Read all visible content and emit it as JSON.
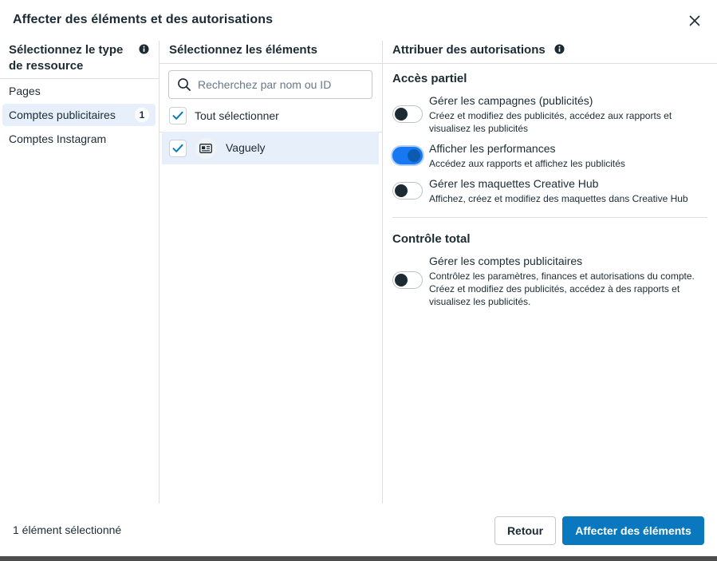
{
  "dialog": {
    "title": "Affecter des éléments et des autorisations"
  },
  "resource_types": {
    "heading": "Sélectionnez le type de ressource",
    "items": [
      {
        "label": "Pages",
        "count": ""
      },
      {
        "label": "Comptes publicitaires",
        "count": "1"
      },
      {
        "label": "Comptes Instagram",
        "count": ""
      }
    ],
    "active_index": 1
  },
  "elements": {
    "heading": "Sélectionnez les éléments",
    "search_placeholder": "Recherchez par nom ou ID",
    "select_all_label": "Tout sélectionner",
    "select_all_checked": true,
    "items": [
      {
        "name": "Vaguely",
        "checked": true
      }
    ]
  },
  "permissions": {
    "heading": "Attribuer des autorisations",
    "partial_title": "Accès partiel",
    "partial": [
      {
        "title": "Gérer les campagnes (publicités)",
        "desc": "Créez et modifiez des publicités, accédez aux rapports et visualisez les publicités",
        "enabled": false
      },
      {
        "title": "Afficher les performances",
        "desc": "Accédez aux rapports et affichez les publicités",
        "enabled": true
      },
      {
        "title": "Gérer les maquettes Creative Hub",
        "desc": "Affichez, créez et modifiez des maquettes dans Creative Hub",
        "enabled": false
      }
    ],
    "full_title": "Contrôle total",
    "full": [
      {
        "title": "Gérer les comptes publicitaires",
        "desc": "Contrôlez les paramètres, finances et autorisations du compte. Créez et modifiez des publicités, accédez à des rapports et visualisez les publicités.",
        "enabled": false
      }
    ]
  },
  "footer": {
    "status": "1 élément sélectionné",
    "back_label": "Retour",
    "assign_label": "Affecter des éléments"
  },
  "colors": {
    "primary": "#0a78be",
    "toggle_on": "#1877f2",
    "selected_row": "#e7f0fa",
    "text": "#1c2b33"
  },
  "icons": {
    "close": "close-icon",
    "info": "info-icon",
    "search": "search-icon",
    "check": "checkmark-icon",
    "ad_account": "ad-account-icon"
  }
}
